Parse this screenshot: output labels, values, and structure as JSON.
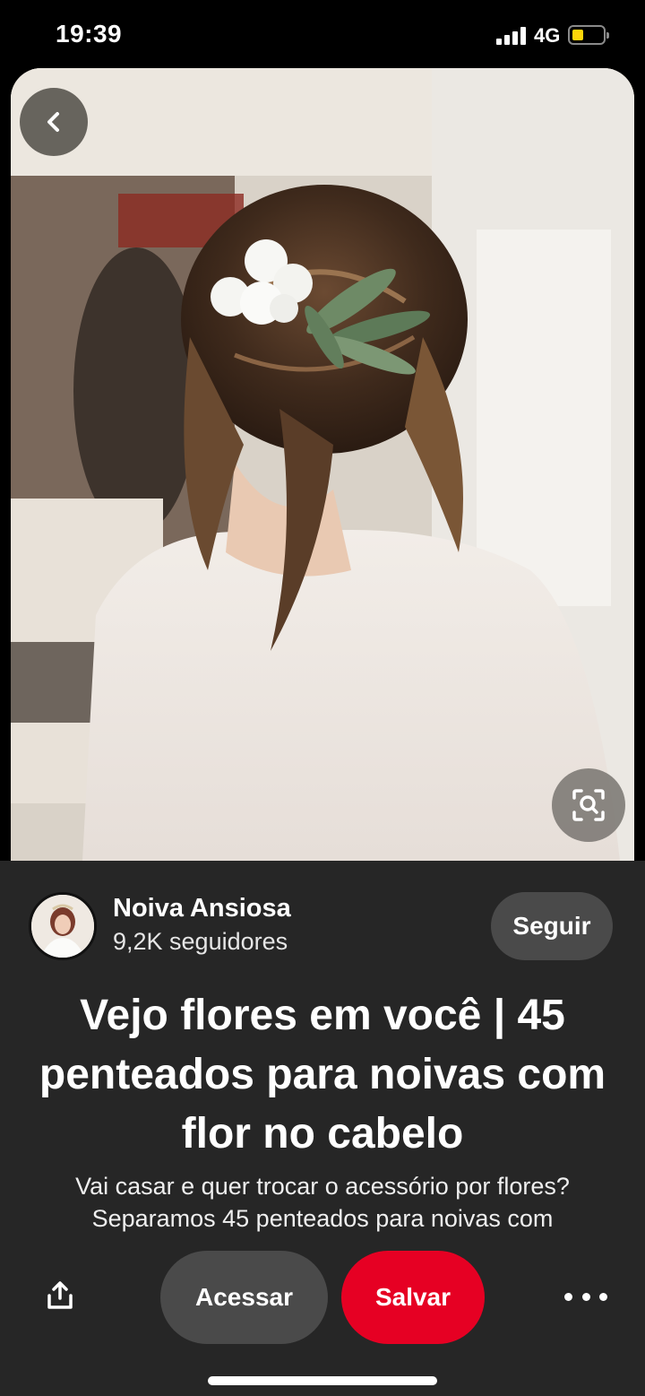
{
  "status_bar": {
    "time": "19:39",
    "network": "4G"
  },
  "pin": {
    "image_alt": "Bride with low messy bun and white flowers in hair"
  },
  "creator": {
    "name": "Noiva Ansiosa",
    "followers": "9,2K seguidores",
    "follow_label": "Seguir"
  },
  "title": "Vejo flores em você | 45 penteados para noivas com flor no cabelo",
  "description": "Vai casar e quer trocar o acessório por flores? Separamos 45 penteados para noivas com",
  "actions": {
    "visit_label": "Acessar",
    "save_label": "Salvar"
  },
  "icons": {
    "back": "chevron-left-icon",
    "lens": "visual-search-icon",
    "share": "share-icon",
    "more": "more-horizontal-icon"
  },
  "colors": {
    "panel_bg": "#262626",
    "save_red": "#e60023",
    "button_gray": "#4a4a4a"
  }
}
